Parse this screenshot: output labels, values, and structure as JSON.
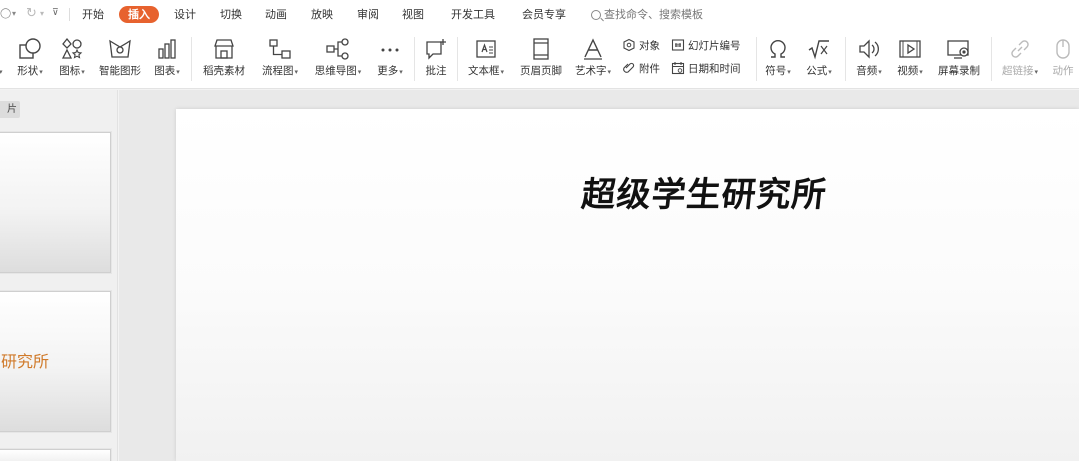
{
  "quick_access": {
    "redo_symbol": "↻",
    "dropdown_symbol": "▾"
  },
  "menu": {
    "tabs": [
      {
        "label": "开始"
      },
      {
        "label": "插入",
        "active": true
      },
      {
        "label": "设计"
      },
      {
        "label": "切换"
      },
      {
        "label": "动画"
      },
      {
        "label": "放映"
      },
      {
        "label": "审阅"
      },
      {
        "label": "视图"
      },
      {
        "label": "开发工具"
      },
      {
        "label": "会员专享"
      }
    ],
    "search_placeholder": "查找命令、搜索模板",
    "accent_color": "#e7622e"
  },
  "ribbon": {
    "shape": "形状",
    "icon": "图标",
    "smartart": "智能图形",
    "chart": "图表",
    "material": "稻壳素材",
    "flowchart": "流程图",
    "mindmap": "思维导图",
    "more": "更多",
    "comment": "批注",
    "textbox": "文本框",
    "header_footer": "页眉页脚",
    "wordart": "艺术字",
    "object": "对象",
    "attachment": "附件",
    "slide_number": "幻灯片编号",
    "date_time": "日期和时间",
    "symbol": "符号",
    "formula": "公式",
    "audio": "音频",
    "video": "视频",
    "screen_record": "屏幕录制",
    "hyperlink": "超链接",
    "action": "动作"
  },
  "left_panel": {
    "tab_label": "片",
    "thumb2_text": "研究所"
  },
  "slide": {
    "title": "超级学生研究所"
  }
}
